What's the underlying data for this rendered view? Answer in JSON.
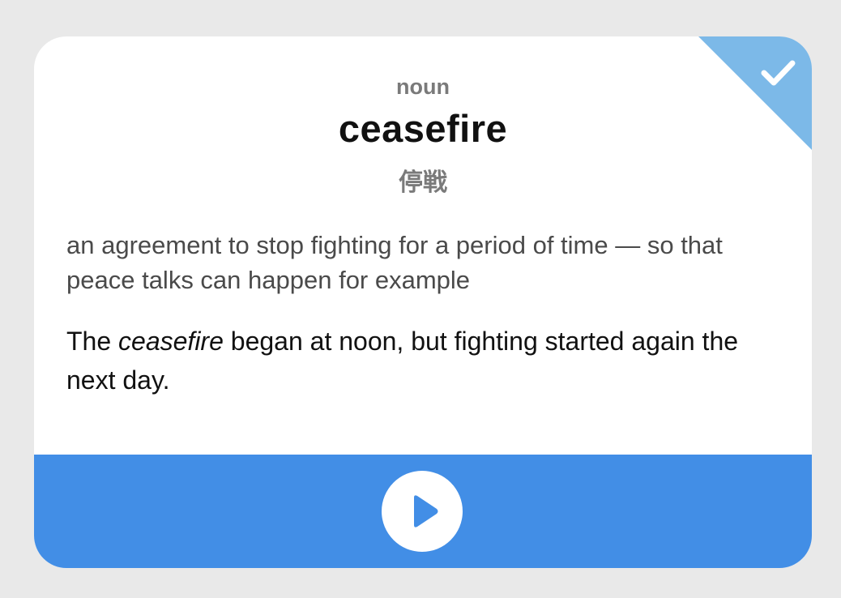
{
  "card": {
    "part_of_speech": "noun",
    "word": "ceasefire",
    "translation": "停戦",
    "definition": "an agreement to stop fighting for a period of time — so that peace talks can happen for example",
    "example": {
      "before": "The ",
      "highlight": "ceasefire",
      "after": " began at noon, but fighting started again the next day."
    },
    "status": {
      "icon": "checkmark-icon",
      "color": "#7cb9e8"
    }
  },
  "footer": {
    "color": "#428ee6",
    "play_icon": "play-icon"
  },
  "colors": {
    "background": "#e9e9e9",
    "card": "#ffffff",
    "accent": "#428ee6"
  }
}
